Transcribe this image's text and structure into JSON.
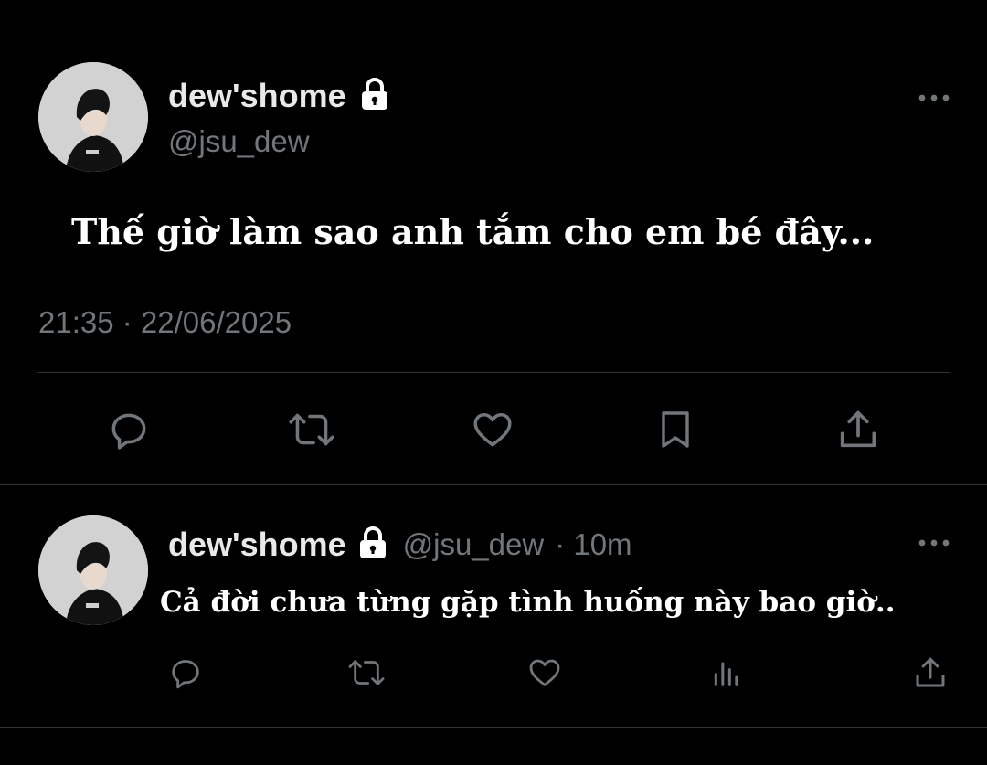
{
  "main_tweet": {
    "display_name": "dew'shome",
    "handle": "@jsu_dew",
    "text": "Thế giờ làm sao anh tắm cho em bé đây...",
    "timestamp": "21:35 · 22/06/2025",
    "more_icon": "more-horizontal-icon",
    "actions": [
      "reply-icon",
      "retweet-icon",
      "like-icon",
      "bookmark-icon",
      "share-icon"
    ]
  },
  "reply_tweet": {
    "display_name": "dew'shome",
    "handle": "@jsu_dew",
    "time_ago": "· 10m",
    "text": "Cả đời chưa từng gặp tình huống này bao giờ..",
    "more_icon": "more-horizontal-icon",
    "actions": [
      "reply-icon",
      "retweet-icon",
      "like-icon",
      "views-icon",
      "share-icon"
    ]
  },
  "colors": {
    "background": "#000000",
    "primary_text": "#e7e9ea",
    "secondary_text": "#71767b",
    "divider": "#2f3336"
  }
}
